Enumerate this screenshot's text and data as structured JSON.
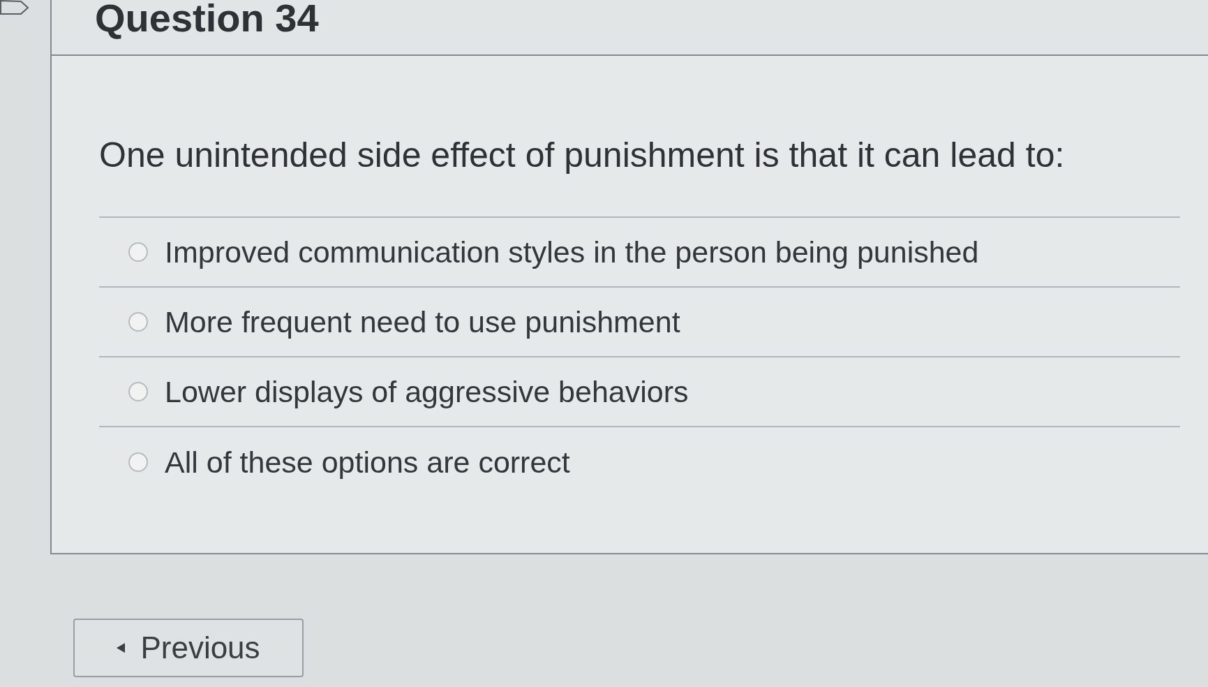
{
  "question": {
    "flagged": false,
    "title": "Question 34",
    "text": "One unintended side effect of punishment is that it can lead to:",
    "options": [
      {
        "label": "Improved communication styles in the person being punished",
        "selected": false
      },
      {
        "label": "More frequent need to use punishment",
        "selected": false
      },
      {
        "label": "Lower displays of aggressive behaviors",
        "selected": false
      },
      {
        "label": "All of these options are correct",
        "selected": false
      }
    ]
  },
  "navigation": {
    "previous": "Previous"
  }
}
